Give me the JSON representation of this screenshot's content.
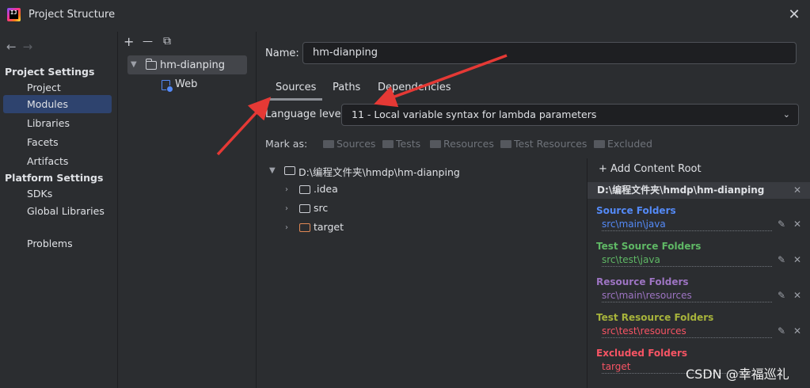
{
  "window": {
    "title": "Project Structure",
    "close_glyph": "✕"
  },
  "sidebar": {
    "back_glyph": "←",
    "forward_glyph": "→",
    "project_settings_header": "Project Settings",
    "project_settings_items": [
      "Project",
      "Modules",
      "Libraries",
      "Facets",
      "Artifacts"
    ],
    "platform_settings_header": "Platform Settings",
    "platform_settings_items": [
      "SDKs",
      "Global Libraries"
    ],
    "other_items": [
      "Problems"
    ],
    "selected": "Modules"
  },
  "module_tree": {
    "toolbar": {
      "add_glyph": "+",
      "remove_glyph": "—",
      "copy_glyph": "⧉"
    },
    "module_name": "hm-dianping",
    "facet_name": "Web"
  },
  "module_settings": {
    "name_label": "Name:",
    "name_value": "hm-dianping",
    "tabs": [
      "Sources",
      "Paths",
      "Dependencies"
    ],
    "active_tab": "Sources",
    "language_level_label": "Language level:",
    "language_level_value": "11 - Local variable syntax for lambda parameters",
    "mark_as_label": "Mark as:",
    "mark_as_buttons": [
      "Sources",
      "Tests",
      "Resources",
      "Test Resources",
      "Excluded"
    ]
  },
  "file_tree": {
    "root": "D:\\编程文件夹\\hmdp\\hm-dianping",
    "children": [
      ".idea",
      "src",
      "target"
    ]
  },
  "content_roots": {
    "add_label": "+ Add Content Root",
    "root_path": "D:\\编程文件夹\\hmdp\\hm-dianping",
    "groups": [
      {
        "title": "Source Folders",
        "path": "src\\main\\java",
        "color": "#548af7"
      },
      {
        "title": "Test Source Folders",
        "path": "src\\test\\java",
        "color": "#5fb865"
      },
      {
        "title": "Resource Folders",
        "path": "src\\main\\resources",
        "color": "#9d74c2"
      },
      {
        "title": "Test Resource Folders",
        "path": "src\\test\\resources",
        "color": "#a7b33b"
      },
      {
        "title": "Excluded Folders",
        "path": "target",
        "color": "#f75464"
      }
    ]
  },
  "watermark": "CSDN @幸福巡礼",
  "colors": {
    "selection": "#2e436e",
    "annotation_arrow": "#e53935"
  }
}
